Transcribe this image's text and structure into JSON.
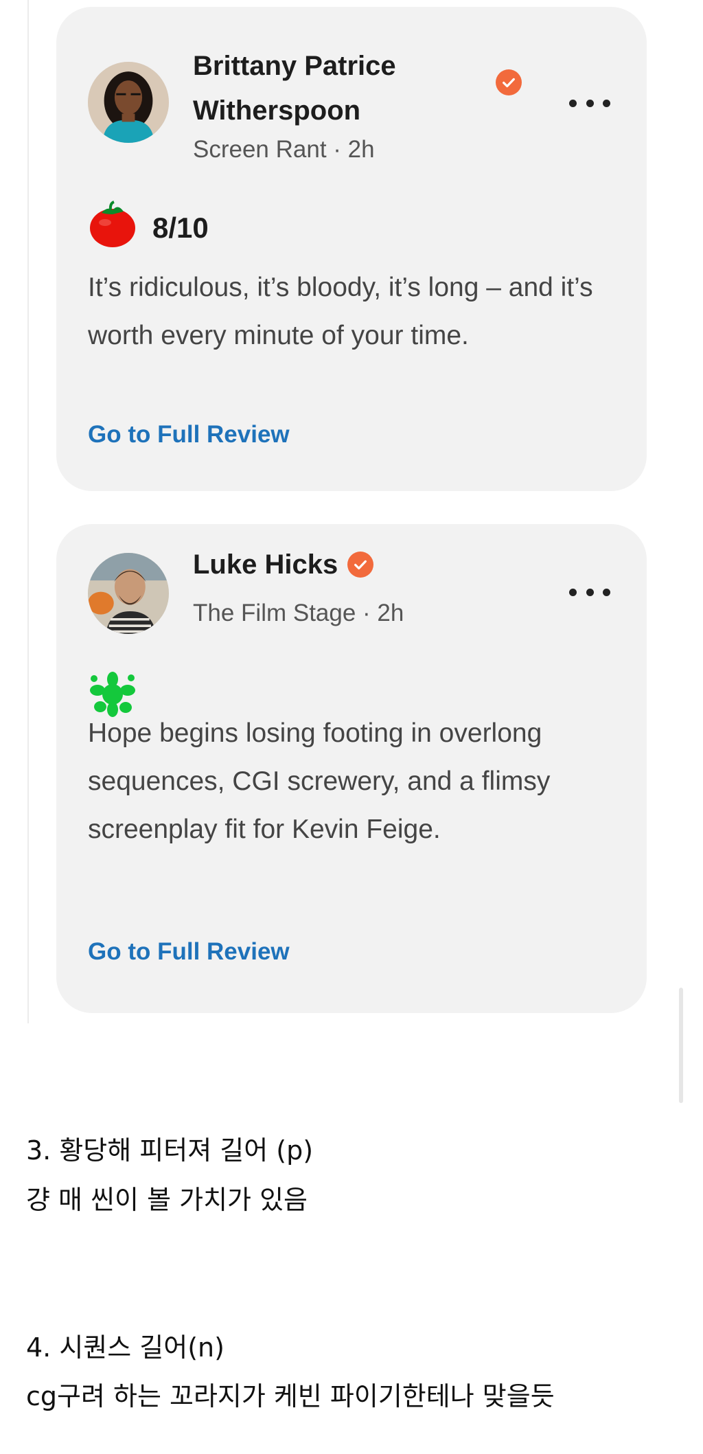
{
  "reviews": [
    {
      "author_line1": "Brittany Patrice",
      "author_line2": "Witherspoon",
      "publication": "Screen Rant",
      "separator": " · ",
      "time": "2h",
      "verified_icon": "verified-badge-icon",
      "score_icon": "fresh-tomato-icon",
      "score": "8/10",
      "quote": "It’s ridiculous, it’s bloody, it’s long – and it’s worth every minute of your time.",
      "link_label": "Go to Full Review"
    },
    {
      "author_line1": "Luke Hicks",
      "publication": "The Film Stage",
      "separator": " · ",
      "time": "2h",
      "verified_icon": "verified-badge-icon",
      "score_icon": "rotten-splat-icon",
      "quote": "Hope begins losing footing in overlong sequences, CGI screwery, and a flimsy screenplay fit for Kevin Feige.",
      "link_label": "Go to Full Review"
    }
  ],
  "notes": [
    {
      "line1": "3. 황당해 피터져 길어 (p)",
      "line2": "걍 매 씬이 볼 가치가 있음"
    },
    {
      "line1": "4. 시퀀스 길어(n)",
      "line2": "cg구려 하는 꼬라지가 케빈 파이기한테나 맞을듯"
    }
  ],
  "colors": {
    "card_bg": "#f2f2f2",
    "link": "#1e72ba",
    "verified": "#f26a3c",
    "tomato": "#e8140c",
    "splat": "#14c83c"
  }
}
